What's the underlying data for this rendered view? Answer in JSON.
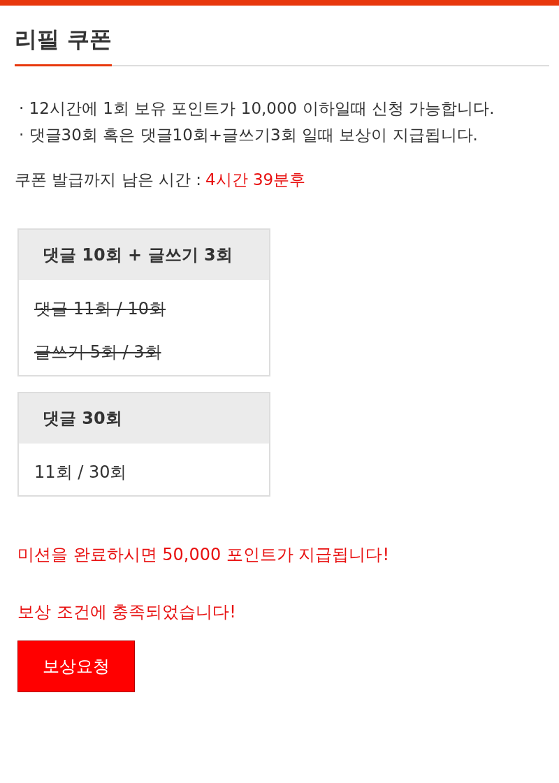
{
  "title": "리필 쿠폰",
  "notes": [
    "· 12시간에 1회 보유 포인트가 10,000 이하일때 신청 가능합니다.",
    "· 댓글30회 혹은 댓글10회+글쓰기3회 일때 보상이 지급됩니다."
  ],
  "countdown": {
    "label": "쿠폰 발급까지 남은 시간 :",
    "value": "4시간 39분후"
  },
  "missions": [
    {
      "title": "댓글 10회 + 글쓰기 3회",
      "lines": [
        {
          "text": "댓글 11회 / 10회",
          "completed": true
        },
        {
          "text": "글쓰기 5회 / 3회",
          "completed": true
        }
      ]
    },
    {
      "title": "댓글 30회",
      "lines": [
        {
          "text": "11회 / 30회",
          "completed": false
        }
      ]
    }
  ],
  "reward_message": "미션을 완료하시면 50,000 포인트가 지급됩니다!",
  "status_message": "보상 조건에 충족되었습니다!",
  "request_button": {
    "label": "보상요청",
    "disabled": false
  }
}
